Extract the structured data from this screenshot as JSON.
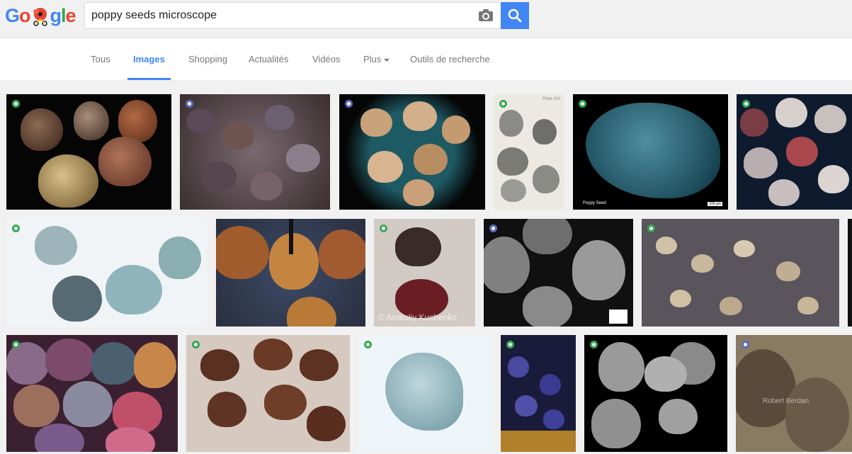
{
  "header": {
    "logo": {
      "letters": [
        "G",
        "o",
        "g",
        "l",
        "e"
      ],
      "doodle_icon": "poppy-doodle-icon"
    },
    "search": {
      "value": "poppy seeds microscope",
      "placeholder": ""
    },
    "camera_icon": "camera-icon",
    "search_icon": "search-icon"
  },
  "tabs": [
    {
      "label": "Tous",
      "active": false
    },
    {
      "label": "Images",
      "active": true
    },
    {
      "label": "Shopping",
      "active": false
    },
    {
      "label": "Actualités",
      "active": false
    },
    {
      "label": "Vidéos",
      "active": false
    },
    {
      "label": "Plus",
      "active": false,
      "dropdown": true
    },
    {
      "label": "Outils de recherche",
      "active": false
    }
  ],
  "results": [
    {
      "badge": "green"
    },
    {
      "badge": "blue"
    },
    {
      "badge": "blue"
    },
    {
      "badge": "green",
      "watermark": "Plate XXI"
    },
    {
      "badge": "green",
      "watermark": "Poppy Seed",
      "scale": "100 µm"
    },
    {
      "badge": "green"
    },
    {
      "badge": "green"
    },
    {
      "badge": "none"
    },
    {
      "badge": "green",
      "watermark": "© Anatoliy Kuchenko"
    },
    {
      "badge": "blue"
    },
    {
      "badge": "green"
    },
    {
      "badge": "green"
    },
    {
      "badge": "green"
    },
    {
      "badge": "green"
    },
    {
      "badge": "green"
    },
    {
      "badge": "green"
    },
    {
      "badge": "blue",
      "watermark": "Robert Berdan"
    }
  ],
  "colors": {
    "blue": "#4285f4",
    "red": "#ea4335",
    "yellow": "#fbbc05",
    "green": "#34a853",
    "tab_inactive": "#777777"
  }
}
